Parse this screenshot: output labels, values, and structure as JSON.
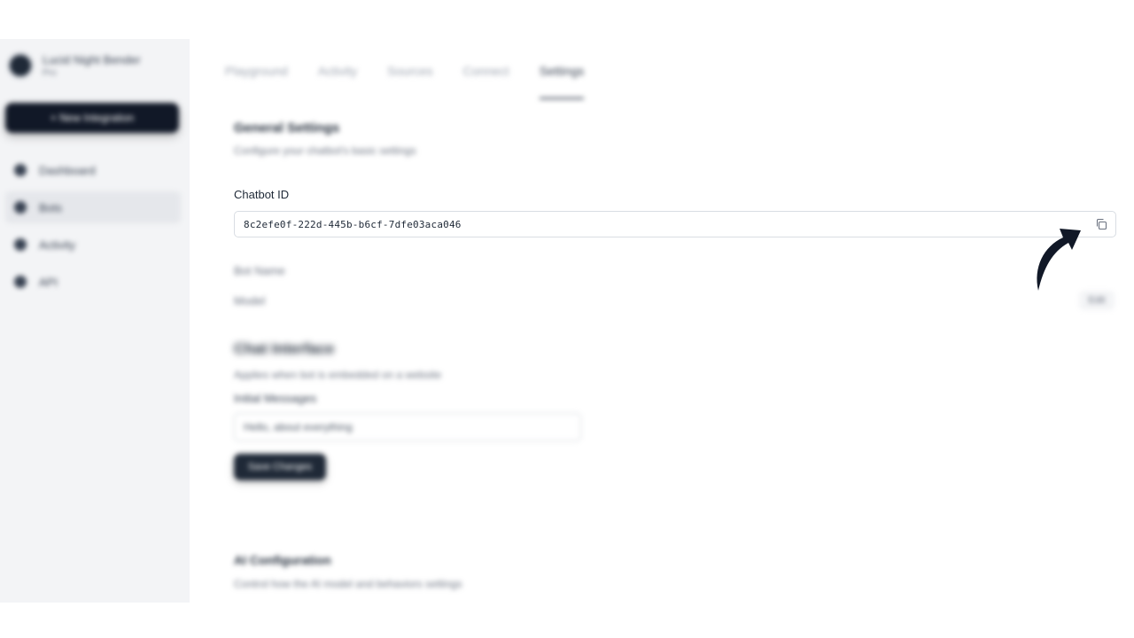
{
  "sidebar": {
    "profile_name": "Lucid Night Bender",
    "profile_sub": "Pro",
    "new_button_label": "+ New Integration",
    "items": [
      {
        "label": "Dashboard",
        "icon": "dashboard-icon",
        "active": false
      },
      {
        "label": "Bots",
        "icon": "bot-icon",
        "active": true
      },
      {
        "label": "Activity",
        "icon": "activity-icon",
        "active": false
      },
      {
        "label": "API",
        "icon": "api-icon",
        "active": false
      }
    ]
  },
  "tabs": [
    {
      "label": "Playground",
      "active": false
    },
    {
      "label": "Activity",
      "active": false
    },
    {
      "label": "Sources",
      "active": false
    },
    {
      "label": "Connect",
      "active": false
    },
    {
      "label": "Settings",
      "active": true
    }
  ],
  "general": {
    "title": "General Settings",
    "description": "Configure your chatbot's basic settings"
  },
  "chatbot_id": {
    "label": "Chatbot ID",
    "value": "8c2efe0f-222d-445b-b6cf-7dfe03aca046",
    "copy_icon": "copy-icon"
  },
  "fields": {
    "bot_name_label": "Bot Name",
    "model_label": "Model",
    "edit_label": "Edit"
  },
  "chat_interface": {
    "title": "Chat Interface",
    "description": "Applies when bot is embedded on a website",
    "initial_message_label": "Initial Messages",
    "initial_message_value": "Hello, about everything",
    "save_button_label": "Save Changes"
  },
  "ai_config": {
    "title": "AI Configuration",
    "description": "Control how the AI model and behaviors settings"
  },
  "colors": {
    "accent": "#111827",
    "sidebar_bg": "#f3f4f6",
    "annotation_arrow": "#111827"
  }
}
